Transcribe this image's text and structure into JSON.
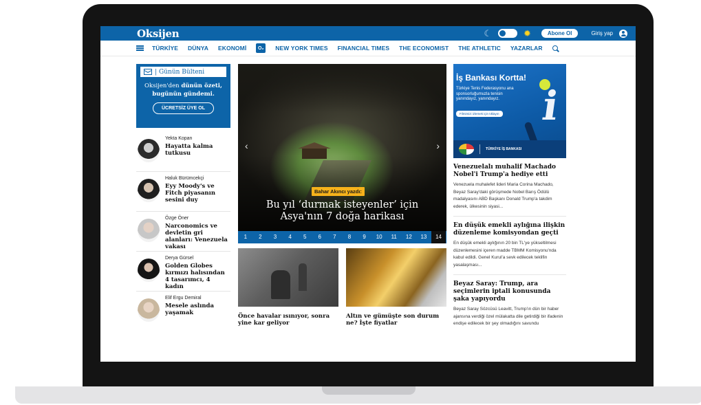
{
  "colors": {
    "brand_blue": "#0d64a8",
    "kicker_yellow": "#f6b21b",
    "sun_yellow": "#ffd21f",
    "laptop_frame": "#141414"
  },
  "header": {
    "logo": "Oksijen",
    "subscribe_label": "Abone Ol",
    "login_label": "Giriş yap",
    "icons": [
      "moon-icon",
      "theme-toggle",
      "sun-icon",
      "user-icon"
    ]
  },
  "nav": {
    "items": [
      "TÜRKİYE",
      "DÜNYA",
      "EKONOMİ"
    ],
    "o2_badge": "O₂",
    "items_after": [
      "NEW YORK TIMES",
      "FINANCIAL TIMES",
      "THE ECONOMIST",
      "THE ATHLETIC",
      "YAZARLAR"
    ]
  },
  "newsletter": {
    "title": "Günün Bülteni",
    "text_line1": "Oksijen'den",
    "text_bold1": "dünün özeti,",
    "text_bold2": "bugünün gündemi.",
    "button": "ÜCRETSİZ ÜYE OL"
  },
  "authors": [
    {
      "name": "Yekta Kopan",
      "title": "Hayatta kalma tutkusu"
    },
    {
      "name": "Haluk Bürümcekçi",
      "title": "Eyy Moody's ve Fitch piyasanın sesini duy"
    },
    {
      "name": "Özge Öner",
      "title": "Narconomics ve devletin gri alanları: Venezuela vakası"
    },
    {
      "name": "Derya Gürsel",
      "title": "Golden Globes kırmızı halısından 4 tasarımcı, 4 kadın"
    },
    {
      "name": "Elif Ergu Demiral",
      "title": "Mesele aslında yaşamak"
    }
  ],
  "hero": {
    "kicker": "Bahar Akıncı yazdı:",
    "title": "Bu yıl ‘durmak isteyenler’ için Asya'nın 7 doğa harikası",
    "pages": [
      "1",
      "2",
      "3",
      "4",
      "5",
      "6",
      "7",
      "8",
      "9",
      "10",
      "11",
      "12",
      "13",
      "14"
    ],
    "active_page": "14",
    "prev_label": "‹",
    "next_label": "›"
  },
  "cards": [
    {
      "title": "Önce havalar ısınıyor, sonra yine kar geliyor"
    },
    {
      "title": "Altın ve gümüşte son durum ne? İşte fiyatlar"
    }
  ],
  "ad": {
    "title": "İş Bankası Kortta!",
    "text": "Türkiye Tenis Federasyonu ana sponsorluğumuzla tenisin yanındayız, yanındayız.",
    "button": "Filmimizi izlemek için tıklayın",
    "footer": "TÜRKİYE İŞ BANKASI"
  },
  "stories": [
    {
      "title": "Venezuelalı muhalif Machado Nobel'i Trump'a hediye etti",
      "body": "Venezuela muhalefet lideri Maria Corina Machado, Beyaz Saray'daki görüşmede Nobel Barış Ödülü madalyasını ABD Başkanı Donald Trump'a takdim ederek, ülkesinin siyasi..."
    },
    {
      "title": "En düşük emekli aylığına ilişkin düzenleme komisyondan geçti",
      "body": "En düşük emekli aylığının 20 bin TL'ye yükseltilmesi düzenlemesini içeren madde TBMM Komisyonu'nda kabul edildi. Genel Kurul'a sevk edilecek teklifin yasalaşması..."
    },
    {
      "title": "Beyaz Saray: Trump, ara seçimlerin iptali konusunda şaka yapıyordu",
      "body": "Beyaz Saray Sözcüsü Leavitt, Trump'ın dün bir haber ajansına verdiği özel mülakatta dile getirdiği bir ifadenin endişe edilecek bir şey olmadığını savundu"
    }
  ]
}
